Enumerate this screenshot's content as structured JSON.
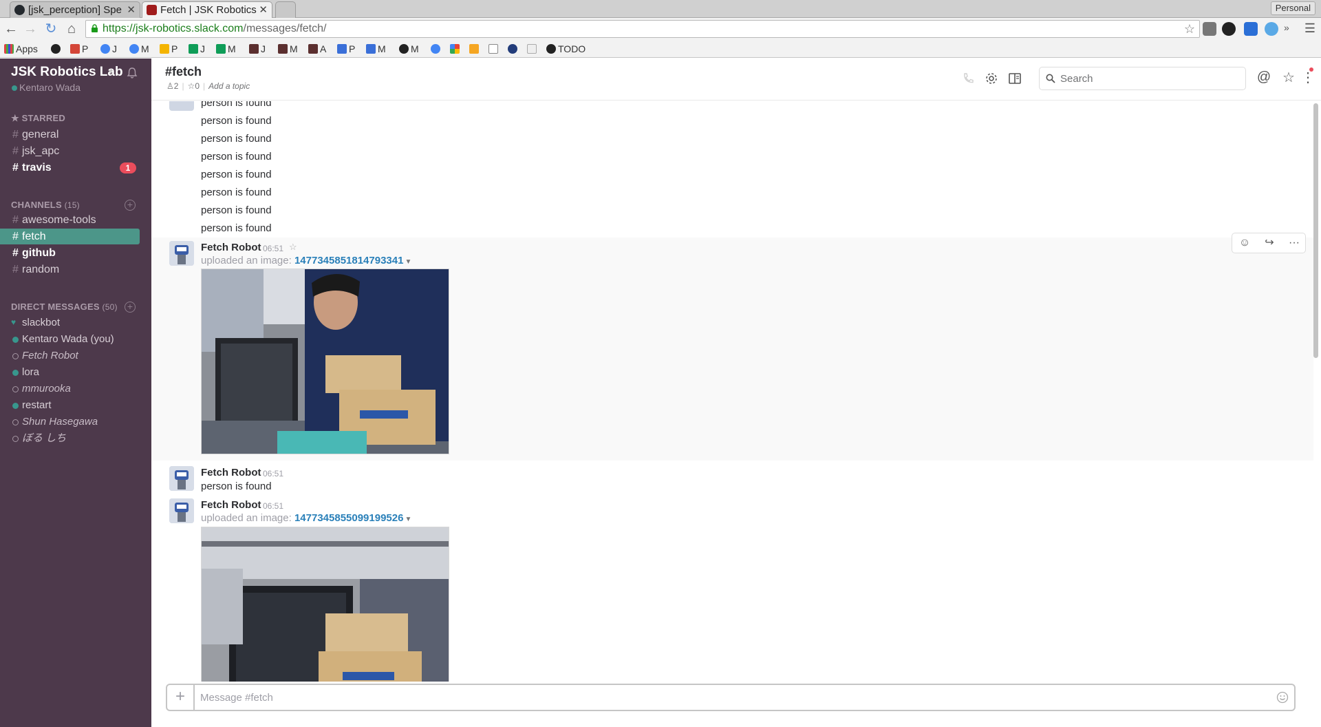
{
  "browser": {
    "tabs": [
      {
        "title": "[jsk_perception] Spe",
        "favicon_color": "#24292e"
      },
      {
        "title": "Fetch | JSK Robotics",
        "favicon_color": "#a01b1b"
      }
    ],
    "profile_label": "Personal",
    "url_host": "https://jsk-robotics.slack.com",
    "url_path": "/messages/fetch/",
    "bookmarks": [
      {
        "label": "Apps",
        "icon": "apps-grid-icon"
      },
      {
        "label": "",
        "icon": "github-icon"
      },
      {
        "label": "P",
        "icon": "gmail-icon"
      },
      {
        "label": "J",
        "icon": "google-icon"
      },
      {
        "label": "M",
        "icon": "google-icon"
      },
      {
        "label": "P",
        "icon": "drive-icon"
      },
      {
        "label": "J",
        "icon": "drive-icon"
      },
      {
        "label": "M",
        "icon": "drive-icon"
      },
      {
        "label": "J",
        "icon": "slack-icon"
      },
      {
        "label": "M",
        "icon": "slack-icon"
      },
      {
        "label": "A",
        "icon": "slack-icon"
      },
      {
        "label": "P",
        "icon": "calendar-icon"
      },
      {
        "label": "M",
        "icon": "calendar-icon"
      },
      {
        "label": "M",
        "icon": "github-icon"
      },
      {
        "label": "",
        "icon": "google-icon"
      },
      {
        "label": "",
        "icon": "photos-icon"
      },
      {
        "label": "",
        "icon": "box-icon"
      },
      {
        "label": "",
        "icon": "doc-icon"
      },
      {
        "label": "",
        "icon": "globe-icon"
      },
      {
        "label": "",
        "icon": "page-icon"
      },
      {
        "label": "TODO",
        "icon": "github-icon"
      }
    ]
  },
  "sidebar": {
    "team_name": "JSK Robotics Lab",
    "user_name": "Kentaro Wada",
    "starred_header": "STARRED",
    "starred": [
      {
        "name": "general",
        "unread": false
      },
      {
        "name": "jsk_apc",
        "unread": false
      },
      {
        "name": "travis",
        "unread": true,
        "badge": "1"
      }
    ],
    "channels_header": "CHANNELS",
    "channels_count": "(15)",
    "channels": [
      {
        "name": "awesome-tools",
        "state": "normal"
      },
      {
        "name": "fetch",
        "state": "active"
      },
      {
        "name": "github",
        "state": "unread"
      },
      {
        "name": "random",
        "state": "normal"
      }
    ],
    "dm_header": "DIRECT MESSAGES",
    "dm_count": "(50)",
    "dms": [
      {
        "name": "slackbot",
        "presence": "heart"
      },
      {
        "name": "Kentaro Wada (you)",
        "presence": "on"
      },
      {
        "name": "Fetch Robot",
        "presence": "off",
        "away": true
      },
      {
        "name": "lora",
        "presence": "on"
      },
      {
        "name": "mmurooka",
        "presence": "off",
        "away": true
      },
      {
        "name": "restart",
        "presence": "on"
      },
      {
        "name": "Shun Hasegawa",
        "presence": "off",
        "away": true
      },
      {
        "name": "ぼる しち",
        "presence": "off",
        "away": true
      }
    ]
  },
  "channel": {
    "name": "#fetch",
    "members": "2",
    "pins": "0",
    "topic_placeholder": "Add a topic",
    "search_placeholder": "Search"
  },
  "messages": {
    "continued_lines": [
      "person is found",
      "person is found",
      "person is found",
      "person is found",
      "person is found",
      "person is found",
      "person is found",
      "person is found"
    ],
    "items": [
      {
        "sender": "Fetch Robot",
        "time": "06:51",
        "upload_prefix": "uploaded an image:",
        "file": "1477345851814793341"
      },
      {
        "sender": "Fetch Robot",
        "time": "06:51",
        "text": "person is found"
      },
      {
        "sender": "Fetch Robot",
        "time": "06:51",
        "upload_prefix": "uploaded an image:",
        "file": "1477345855099199526"
      }
    ]
  },
  "composer": {
    "placeholder": "Message #fetch"
  },
  "colors": {
    "sidebar_bg": "#4d394b",
    "active_channel": "#4c9689",
    "badge": "#eb4d5c",
    "link": "#2a80b9"
  }
}
